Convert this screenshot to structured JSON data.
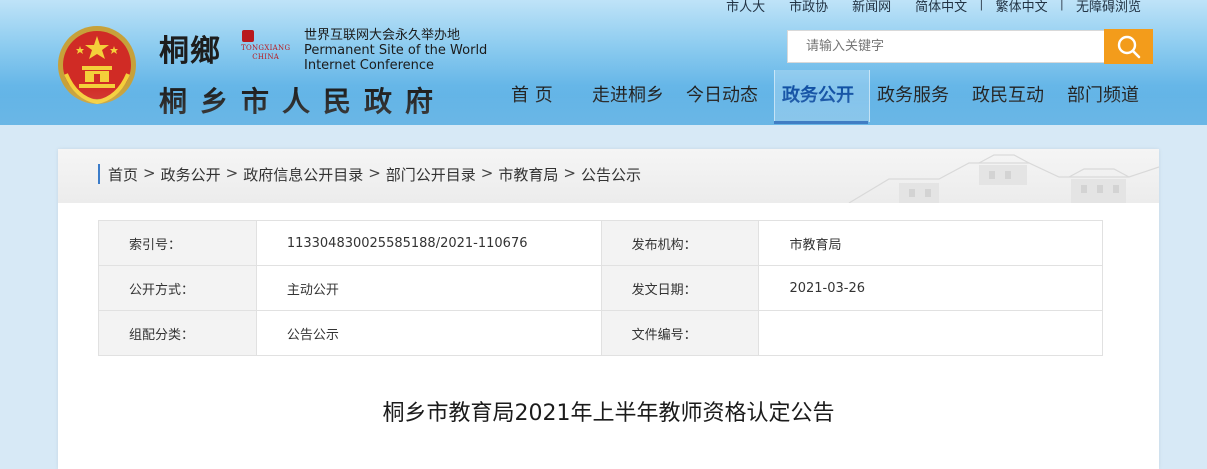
{
  "top_links": [
    "市人大",
    "市政协",
    "新闻网",
    "简体中文",
    "繁体中文",
    "无障碍浏览"
  ],
  "logo": {
    "calligraphy": "桐鄉",
    "en_small": [
      "TONGXIANG",
      "CHINA"
    ],
    "wic_cn": "世界互联网大会永久举办地",
    "wic_en_1": "Permanent Site of the World",
    "wic_en_2": "Internet Conference",
    "site_title": "桐乡市人民政府"
  },
  "search": {
    "placeholder": "请输入关键字"
  },
  "nav": [
    {
      "label": "首 页",
      "active": false
    },
    {
      "label": "走进桐乡",
      "active": false
    },
    {
      "label": "今日动态",
      "active": false
    },
    {
      "label": "政务公开",
      "active": true
    },
    {
      "label": "政务服务",
      "active": false
    },
    {
      "label": "政民互动",
      "active": false
    },
    {
      "label": "部门频道",
      "active": false
    }
  ],
  "breadcrumb": [
    "首页",
    "政务公开",
    "政府信息公开目录",
    "部门公开目录",
    "市教育局",
    "公告公示"
  ],
  "breadcrumb_sep": ">",
  "meta": {
    "rows": [
      {
        "label_1": "索引号：",
        "value_1": "113304830025585188/2021-110676",
        "label_2": "发布机构：",
        "value_2": "市教育局"
      },
      {
        "label_1": "公开方式：",
        "value_1": "主动公开",
        "label_2": "发文日期：",
        "value_2": "2021-03-26"
      },
      {
        "label_1": "组配分类：",
        "value_1": "公告公示",
        "label_2": "文件编号：",
        "value_2": ""
      }
    ]
  },
  "article": {
    "title": "桐乡市教育局2021年上半年教师资格认定公告"
  },
  "colors": {
    "accent": "#f39c1b",
    "nav_active": "#0f4fa3",
    "header_blue": "#5eb2e6"
  }
}
